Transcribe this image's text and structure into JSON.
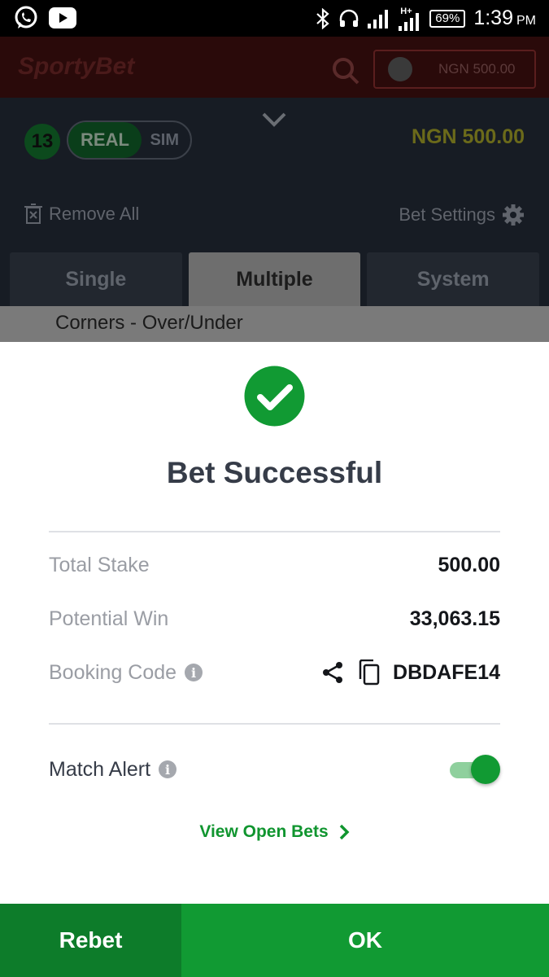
{
  "status_bar": {
    "time": "1:39",
    "ampm": "PM",
    "battery": "69%",
    "network": "H+",
    "icons": [
      "whatsapp-icon",
      "youtube-icon",
      "bluetooth-icon",
      "headset-icon",
      "signal-icon"
    ]
  },
  "header": {
    "logo": "SportyBet",
    "balance": "NGN 500.00"
  },
  "betslip": {
    "selection_count": "13",
    "mode_real": "REAL",
    "mode_sim": "SIM",
    "balance": "NGN 500.00",
    "remove_all": "Remove All",
    "bet_settings": "Bet Settings",
    "tabs": [
      {
        "label": "Single",
        "active": false
      },
      {
        "label": "Multiple",
        "active": true
      },
      {
        "label": "System",
        "active": false
      }
    ],
    "market": "Corners - Over/Under"
  },
  "modal": {
    "title": "Bet Successful",
    "total_stake_label": "Total Stake",
    "total_stake_value": "500.00",
    "potential_win_label": "Potential Win",
    "potential_win_value": "33,063.15",
    "booking_code_label": "Booking Code",
    "booking_code_value": "DBDAFE14",
    "match_alert_label": "Match Alert",
    "match_alert_on": true,
    "view_open_bets": "View Open Bets"
  },
  "footer": {
    "rebet": "Rebet",
    "ok": "OK"
  },
  "colors": {
    "accent_green": "#119a33",
    "dark_green": "#0d7c2a",
    "title": "#363c48"
  }
}
